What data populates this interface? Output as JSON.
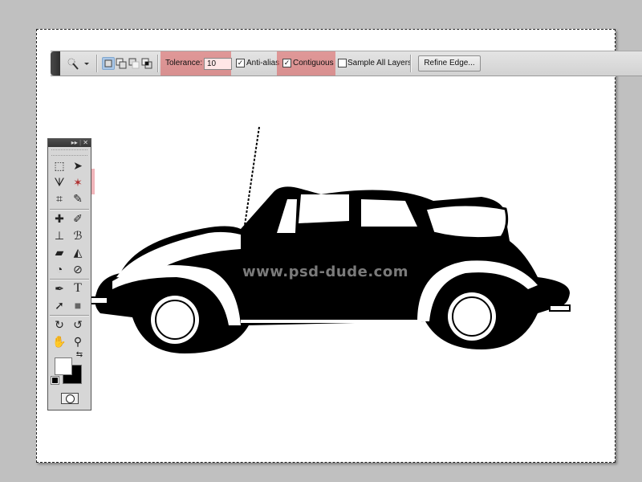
{
  "options_bar": {
    "tool_preset_icon": "magic-wand-icon",
    "selection_modes": [
      {
        "name": "new-selection",
        "active": true
      },
      {
        "name": "add-to-selection",
        "active": false
      },
      {
        "name": "subtract-from-selection",
        "active": false
      },
      {
        "name": "intersect-with-selection",
        "active": false
      }
    ],
    "tolerance_label": "Tolerance:",
    "tolerance_value": "10",
    "anti_alias_label": "Anti-alias",
    "anti_alias_checked": true,
    "contiguous_label": "Contiguous",
    "contiguous_checked": true,
    "sample_all_layers_label": "Sample All Layers",
    "sample_all_layers_checked": false,
    "refine_edge_label": "Refine Edge...",
    "check_glyph": "✓",
    "highlight_color": "#dc5a5a"
  },
  "tools_panel": {
    "header_expand": "▸▸",
    "header_close": "✕",
    "tools": [
      {
        "name": "marquee-tool",
        "glyph": "⬚"
      },
      {
        "name": "move-tool",
        "glyph": "➤"
      },
      {
        "name": "lasso-tool",
        "glyph": "ᗐ"
      },
      {
        "name": "magic-wand-tool",
        "glyph": "✶",
        "active": true
      },
      {
        "name": "crop-tool",
        "glyph": "⌗"
      },
      {
        "name": "eyedropper-tool",
        "glyph": "✎"
      },
      {
        "name": "healing-brush-tool",
        "glyph": "✚"
      },
      {
        "name": "brush-tool",
        "glyph": "✐"
      },
      {
        "name": "clone-stamp-tool",
        "glyph": "⊥"
      },
      {
        "name": "history-brush-tool",
        "glyph": "ℬ"
      },
      {
        "name": "eraser-tool",
        "glyph": "▰"
      },
      {
        "name": "paint-bucket-tool",
        "glyph": "◭"
      },
      {
        "name": "blur-tool",
        "glyph": "◔"
      },
      {
        "name": "dodge-tool",
        "glyph": "⊘"
      },
      {
        "name": "pen-tool",
        "glyph": "✒"
      },
      {
        "name": "type-tool",
        "glyph": "T"
      },
      {
        "name": "path-selection-tool",
        "glyph": "➚"
      },
      {
        "name": "rectangle-tool",
        "glyph": "■"
      },
      {
        "name": "3d-rotate-tool",
        "glyph": "↻"
      },
      {
        "name": "3d-orbit-tool",
        "glyph": "↺"
      },
      {
        "name": "hand-tool",
        "glyph": "✋"
      },
      {
        "name": "zoom-tool",
        "glyph": "⚲"
      }
    ],
    "swap_colors_glyph": "⇆",
    "foreground_color": "#ffffff",
    "background_color": "#000000"
  },
  "canvas": {
    "image_subject": "black-and-white convertible car",
    "watermark": "www.psd-dude.com"
  }
}
